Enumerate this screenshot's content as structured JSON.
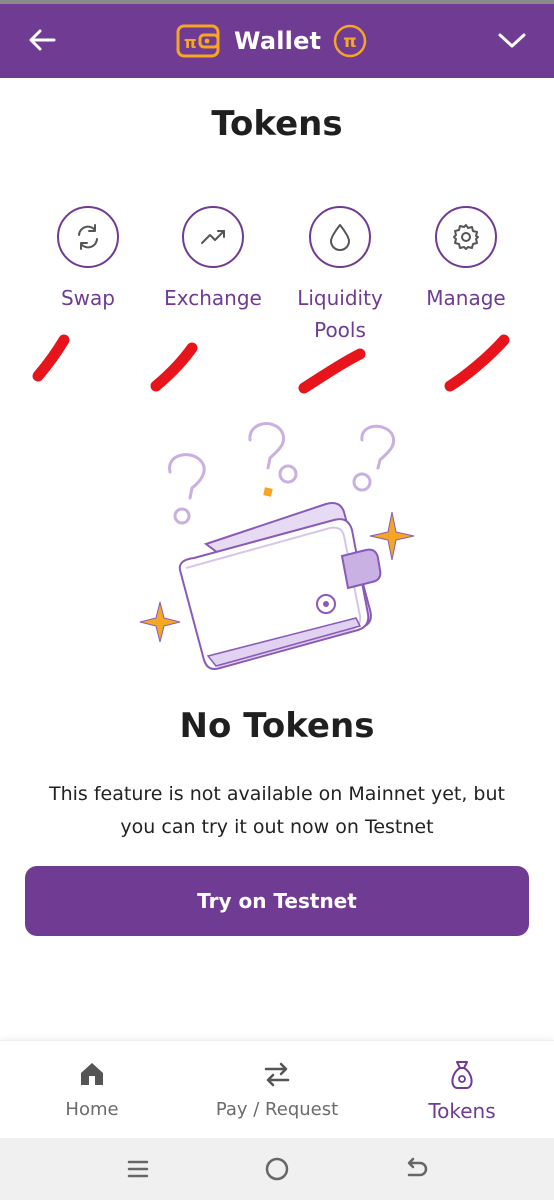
{
  "header": {
    "title": "Wallet",
    "back_icon": "arrow-left-icon",
    "dropdown_icon": "chevron-down-icon",
    "brand_color": "#6f3b93",
    "accent_color": "#f5a623"
  },
  "page": {
    "title": "Tokens"
  },
  "actions": [
    {
      "label": "Swap",
      "icon": "swap-icon"
    },
    {
      "label": "Exchange",
      "icon": "trending-up-icon"
    },
    {
      "label": "Liquidity Pools",
      "label_line1": "Liquidity",
      "label_line2": "Pools",
      "icon": "droplet-icon"
    },
    {
      "label": "Manage",
      "icon": "gear-icon"
    }
  ],
  "empty_state": {
    "title": "No Tokens",
    "description_line1": "This feature is not available on Mainnet yet, but",
    "description_line2": "you can try it out now on Testnet",
    "button_label": "Try on Testnet"
  },
  "bottom_nav": [
    {
      "label": "Home",
      "icon": "home-icon",
      "active": false
    },
    {
      "label": "Pay / Request",
      "icon": "transfer-icon",
      "active": false
    },
    {
      "label": "Tokens",
      "icon": "money-bag-icon",
      "active": true
    }
  ],
  "system_nav": [
    "recents-icon",
    "home-circle-icon",
    "back-icon"
  ]
}
